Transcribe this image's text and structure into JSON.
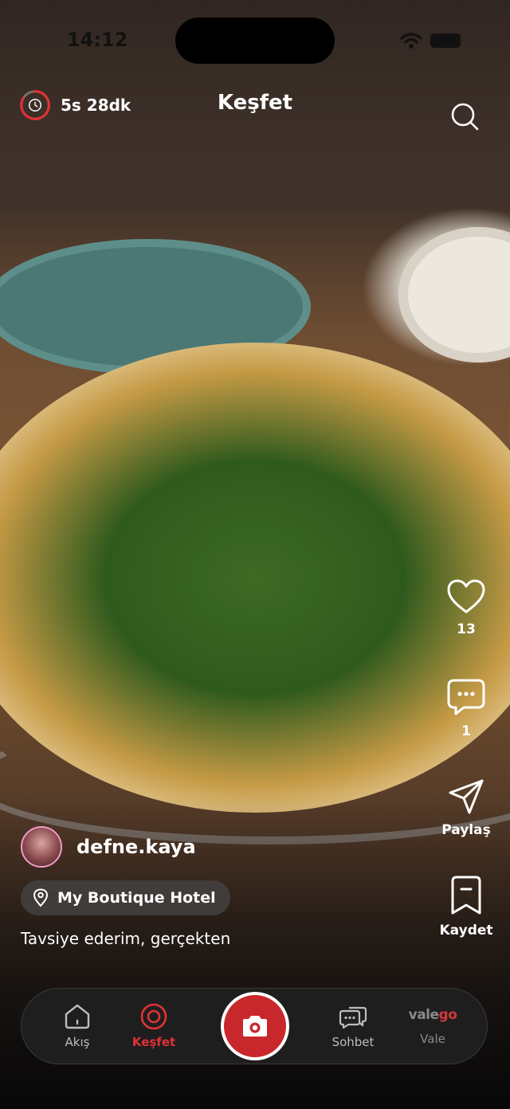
{
  "status_bar": {
    "time": "14:12"
  },
  "header": {
    "timer_text": "5s 28dk",
    "title": "Keşfet",
    "icons": {
      "timer": "clock-icon",
      "search": "search-icon"
    }
  },
  "actions": {
    "like": {
      "icon": "heart-icon",
      "count": "13"
    },
    "comment": {
      "icon": "chat-bubble-icon",
      "count": "1"
    },
    "share": {
      "icon": "send-icon",
      "label": "Paylaş"
    },
    "save": {
      "icon": "bookmark-icon",
      "label": "Kaydet"
    }
  },
  "post": {
    "username": "defne.kaya",
    "location": "My Boutique Hotel",
    "caption": "Tavsiye ederim, gerçekten"
  },
  "nav": {
    "items": [
      {
        "label": "Akış",
        "icon": "home-icon"
      },
      {
        "label": "Keşfet",
        "icon": "compass-icon",
        "active": true
      },
      {
        "label": "",
        "icon": "camera-icon"
      },
      {
        "label": "Sohbet",
        "icon": "chat-icon"
      },
      {
        "label": "Vale",
        "brand_left": "vale",
        "brand_right": "go"
      }
    ]
  },
  "colors": {
    "accent": "#e03236",
    "nav_bg": "#202020"
  }
}
